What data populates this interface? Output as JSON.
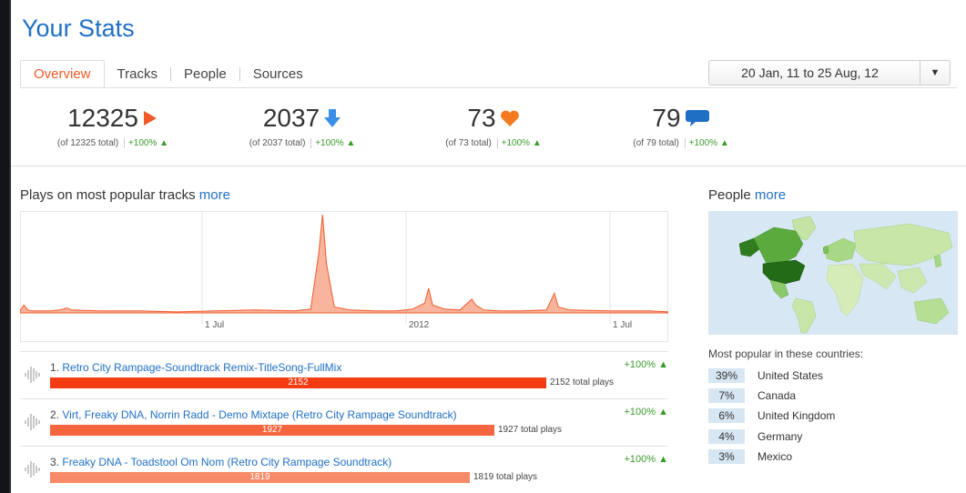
{
  "page": {
    "title": "Your Stats"
  },
  "tabs": [
    {
      "label": "Overview"
    },
    {
      "label": "Tracks"
    },
    {
      "label": "People"
    },
    {
      "label": "Sources"
    }
  ],
  "date_range": {
    "label": "20 Jan, 11 to 25 Aug, 12"
  },
  "stats": [
    {
      "value": "12325",
      "icon": "play-icon",
      "color": "#f05a28",
      "sub": "(of 12325 total)",
      "pct": "+100% ▲"
    },
    {
      "value": "2037",
      "icon": "download-icon",
      "color": "#3b8fe6",
      "sub": "(of 2037 total)",
      "pct": "+100% ▲"
    },
    {
      "value": "73",
      "icon": "heart-icon",
      "color": "#f57a1f",
      "sub": "(of 73 total)",
      "pct": "+100% ▲"
    },
    {
      "value": "79",
      "icon": "comment-icon",
      "color": "#1f6fc5",
      "sub": "(of 79 total)",
      "pct": "+100% ▲"
    }
  ],
  "plays_section": {
    "title": "Plays on most popular tracks",
    "more": "more"
  },
  "chart_data": {
    "type": "area",
    "x_tick_labels": [
      "1 Jul",
      "2012",
      "1 Jul"
    ],
    "series_color": "#f05a28",
    "note_values_relative": true,
    "points": [
      [
        0,
        2
      ],
      [
        1,
        8
      ],
      [
        2,
        3
      ],
      [
        3,
        2
      ],
      [
        8,
        2
      ],
      [
        10,
        3
      ],
      [
        12,
        5
      ],
      [
        13,
        3
      ],
      [
        20,
        2
      ],
      [
        30,
        2
      ],
      [
        40,
        1
      ],
      [
        50,
        2
      ],
      [
        60,
        3
      ],
      [
        70,
        2
      ],
      [
        74,
        4
      ],
      [
        76,
        60
      ],
      [
        77,
        100
      ],
      [
        78,
        50
      ],
      [
        80,
        6
      ],
      [
        84,
        3
      ],
      [
        90,
        2
      ],
      [
        96,
        2
      ],
      [
        100,
        4
      ],
      [
        103,
        10
      ],
      [
        104,
        25
      ],
      [
        105,
        8
      ],
      [
        108,
        4
      ],
      [
        112,
        3
      ],
      [
        115,
        14
      ],
      [
        116,
        8
      ],
      [
        118,
        3
      ],
      [
        122,
        2
      ],
      [
        128,
        2
      ],
      [
        134,
        3
      ],
      [
        136,
        20
      ],
      [
        137,
        6
      ],
      [
        140,
        3
      ],
      [
        150,
        2
      ],
      [
        160,
        2
      ],
      [
        165,
        1
      ]
    ],
    "x_max": 165,
    "y_max": 100
  },
  "tracks": [
    {
      "index": "1.",
      "title": "Retro City Rampage-Soundtrack Remix-TitleSong-FullMix",
      "plays": 2152,
      "plays_label": "2152",
      "total": "2152 total plays",
      "pct": "+100% ▲",
      "color": "#f43c12"
    },
    {
      "index": "2.",
      "title": "Virt, Freaky DNA, Norrin Radd - Demo Mixtape (Retro City Rampage Soundtrack)",
      "plays": 1927,
      "plays_label": "1927",
      "total": "1927 total plays",
      "pct": "+100% ▲",
      "color": "#f5663e"
    },
    {
      "index": "3.",
      "title": "Freaky DNA - Toadstool Om Nom (Retro City Rampage Soundtrack)",
      "plays": 1819,
      "plays_label": "1819",
      "total": "1819 total plays",
      "pct": "+100% ▲",
      "color": "#f78a68"
    }
  ],
  "people_section": {
    "title": "People",
    "more": "more"
  },
  "countries": {
    "title": "Most popular in these countries:",
    "items": [
      {
        "pct": "39%",
        "name": "United States"
      },
      {
        "pct": "7%",
        "name": "Canada"
      },
      {
        "pct": "6%",
        "name": "United Kingdom"
      },
      {
        "pct": "4%",
        "name": "Germany"
      },
      {
        "pct": "3%",
        "name": "Mexico"
      }
    ]
  }
}
